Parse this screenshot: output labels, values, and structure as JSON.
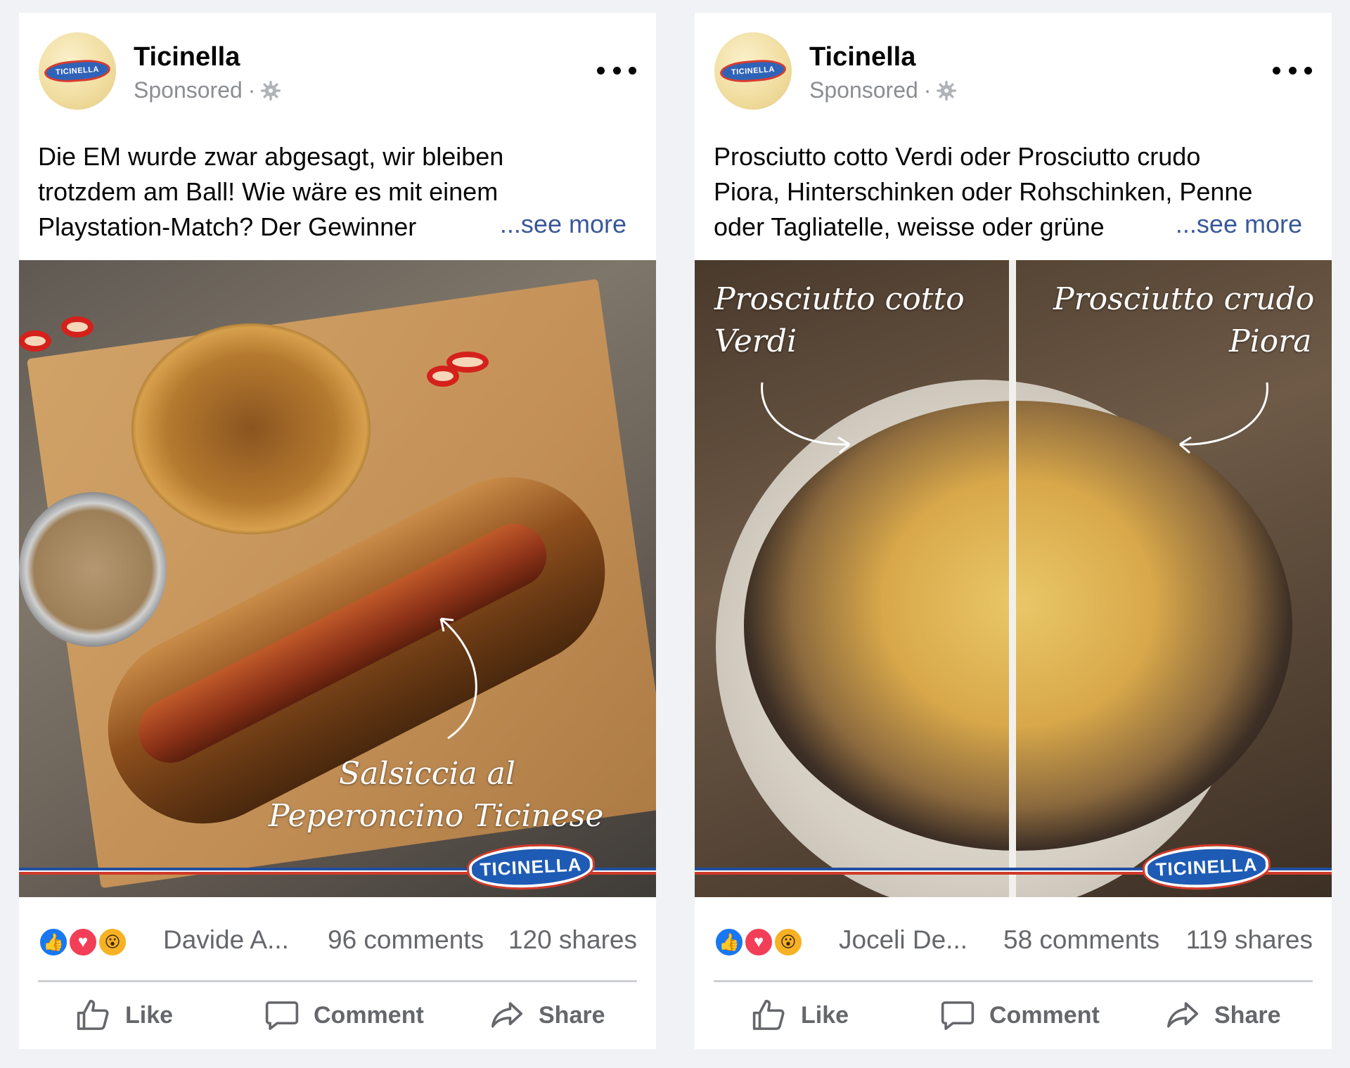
{
  "posts": [
    {
      "page_name": "Ticinella",
      "sponsored": "Sponsored",
      "avatar_text": "TICINELLA",
      "text_lines": [
        "Die EM wurde zwar abgesagt, wir bleiben",
        "trotzdem am Ball! Wie wäre es mit einem",
        "Playstation-Match? Der Gewinner"
      ],
      "see_more": "...see more",
      "media": {
        "captions": [
          "Salsiccia al",
          "Peperoncino Ticinese"
        ],
        "brand": "TICINELLA"
      },
      "reactions": [
        "like",
        "love",
        "wow"
      ],
      "reactor": "Davide A...",
      "comments": "96 comments",
      "shares": "120 shares",
      "actions": {
        "like": "Like",
        "comment": "Comment",
        "share": "Share"
      }
    },
    {
      "page_name": "Ticinella",
      "sponsored": "Sponsored",
      "avatar_text": "TICINELLA",
      "text_lines": [
        "Prosciutto cotto Verdi oder Prosciutto crudo",
        "Piora, Hinterschinken oder Rohschinken, Penne",
        "oder Tagliatelle, weisse oder grüne"
      ],
      "see_more": "...see more",
      "media": {
        "caption_left": [
          "Prosciutto cotto",
          "Verdi"
        ],
        "caption_right": [
          "Prosciutto crudo",
          "Piora"
        ],
        "brand": "TICINELLA"
      },
      "reactions": [
        "like",
        "love",
        "wow"
      ],
      "reactor": "Joceli De...",
      "comments": "58 comments",
      "shares": "119 shares",
      "actions": {
        "like": "Like",
        "comment": "Comment",
        "share": "Share"
      }
    }
  ],
  "icons": {
    "more": "more-horizontal-icon",
    "audience": "gear-icon",
    "like": "thumbs-up-icon",
    "comment": "speech-bubble-icon",
    "share": "share-arrow-icon"
  },
  "colors": {
    "like_blue": "#1877f2",
    "love_red": "#f33e58",
    "wow_yellow": "#f7b125",
    "see_more": "#385898",
    "secondary_text": "#65676b"
  }
}
